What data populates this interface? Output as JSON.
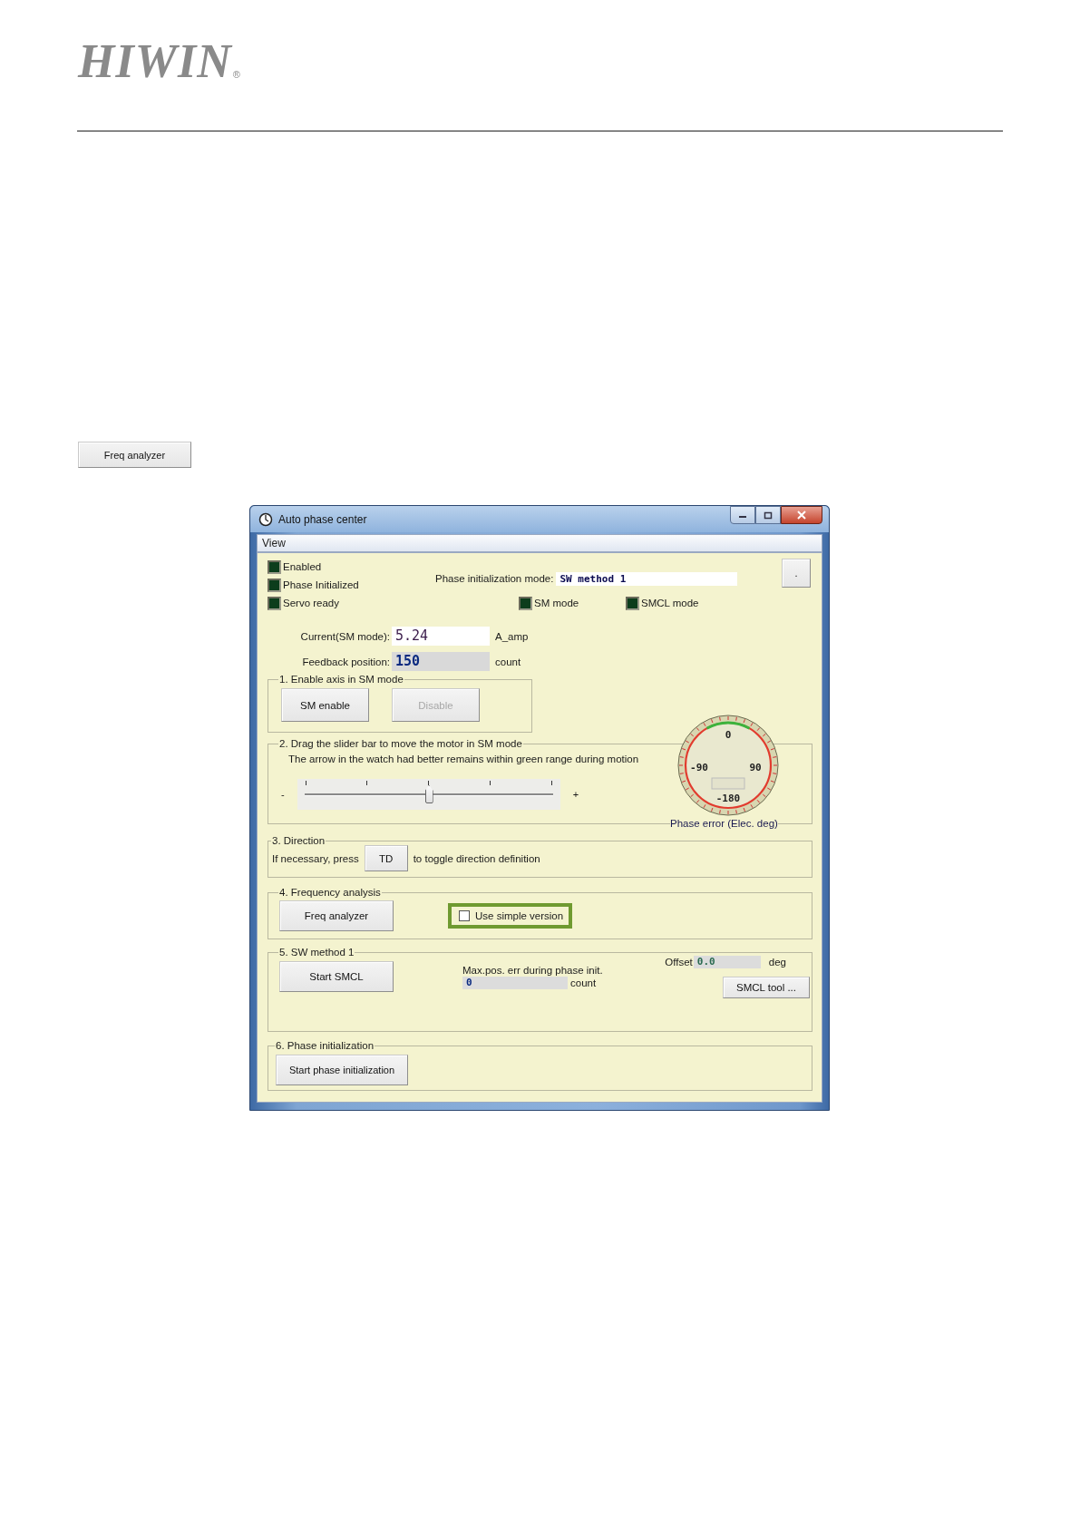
{
  "logo": {
    "text": "HIWIN",
    "mark": "®"
  },
  "top_button": {
    "label": "Freq analyzer"
  },
  "dialog": {
    "title": "Auto phase center",
    "menu": [
      "View"
    ],
    "indicators": [
      {
        "label": "Enabled",
        "on": true
      },
      {
        "label": "Phase Initialized",
        "on": true
      },
      {
        "label": "Servo ready",
        "on": true
      },
      {
        "label": "SM mode",
        "on": true
      },
      {
        "label": "SMCL mode",
        "on": true
      }
    ],
    "phase_mode": {
      "label": "Phase initialization mode:",
      "value": "SW method 1"
    },
    "dot_button": ".",
    "current": {
      "label": "Current(SM mode):",
      "value": "5.24",
      "unit": "A_amp"
    },
    "feedback": {
      "label": "Feedback position:",
      "value": "150",
      "unit": "count"
    },
    "group_1": {
      "title": "1. Enable axis in SM mode",
      "buttons": [
        {
          "label": "SM enable",
          "disabled": false
        },
        {
          "label": "Disable",
          "disabled": true
        }
      ]
    },
    "group_2": {
      "title": "2. Drag the slider bar to move the motor in SM mode",
      "hint": "The arrow in the watch had better remains within green range during motion",
      "minus": "-",
      "plus": "+",
      "slider": {
        "level": 0.5
      },
      "gauge": {
        "labels": [
          "0",
          "-90",
          "90",
          "-180"
        ],
        "caption": "Phase error (Elec. deg)"
      }
    },
    "group_3": {
      "title": "3. Direction",
      "before": "If necessary, press",
      "button": "TD",
      "after": "to toggle direction definition"
    },
    "group_4": {
      "title": "4. Frequency analysis",
      "button": "Freq analyzer",
      "checkbox": {
        "label": "Use simple version",
        "checked": false,
        "highlighted": true
      }
    },
    "group_5": {
      "title": "5. SW method 1",
      "button": "Start SMCL",
      "max_err": {
        "label": "Max.pos. err during phase init.",
        "value": "0",
        "unit": "count"
      },
      "offset": {
        "label": "Offset",
        "value": "0.0",
        "unit": "deg"
      },
      "tool_button": "SMCL tool ..."
    },
    "group_6": {
      "title": "6. Phase initialization",
      "button": "Start phase initialization"
    }
  }
}
